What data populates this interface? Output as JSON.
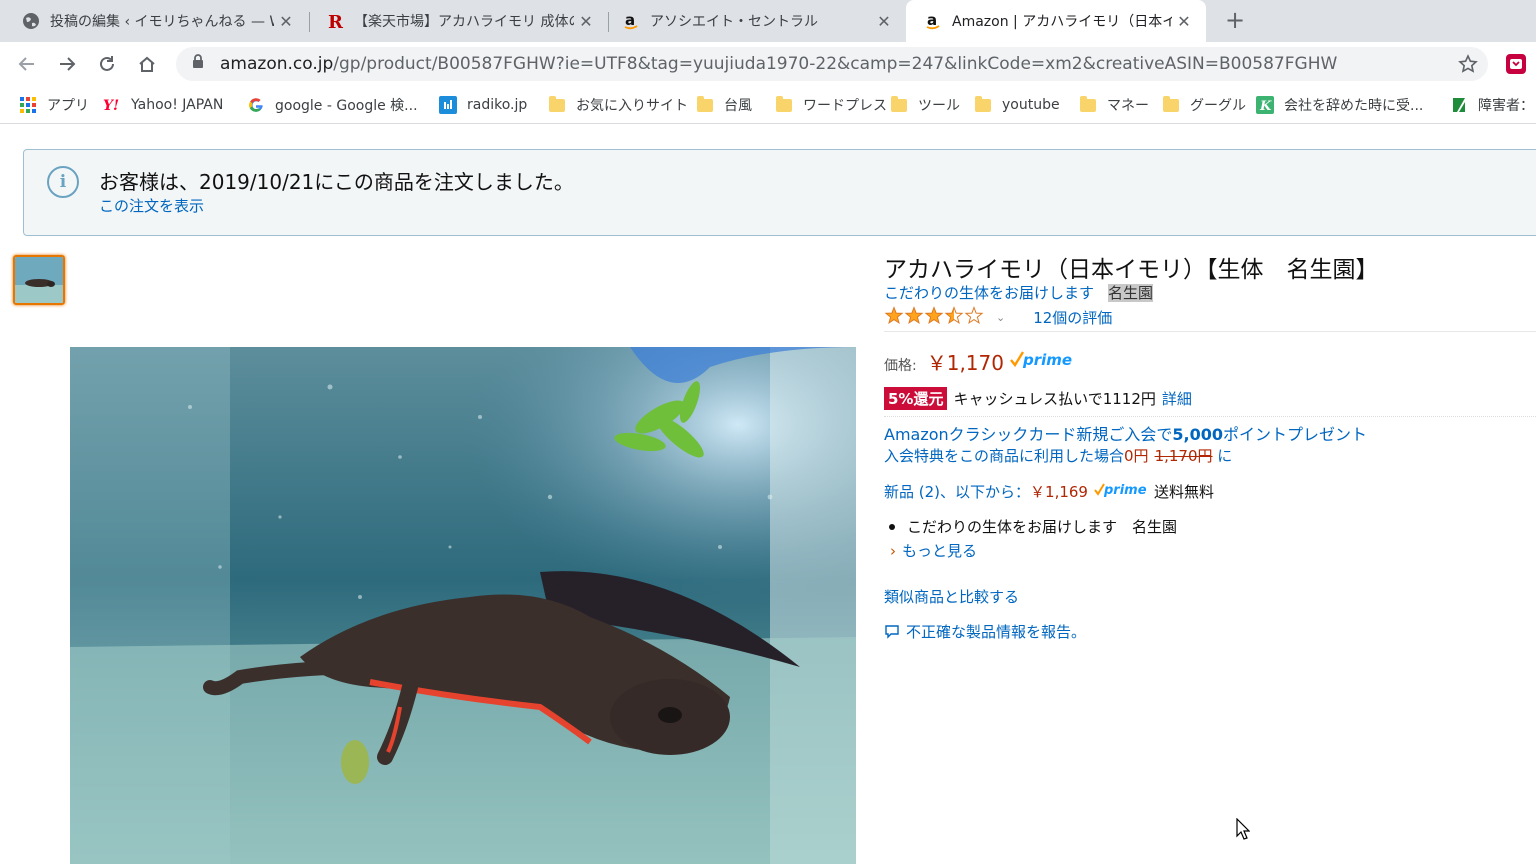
{
  "tabs": [
    {
      "title": "投稿の編集 ‹ イモリちゃんねる — WordPress",
      "favicon": "globe-icon"
    },
    {
      "title": "【楽天市場】アカハライモリ 成体の通販",
      "favicon": "rakuten-icon"
    },
    {
      "title": "アソシエイト・セントラル",
      "favicon": "amazon-icon"
    },
    {
      "title": "Amazon | アカハライモリ（日本イモリ）",
      "favicon": "amazon-icon"
    }
  ],
  "tab_close": "✕",
  "new_tab": "+",
  "url": {
    "host": "amazon.co.jp",
    "path": "/gp/product/B00587FGHW?ie=UTF8&tag=yuujiuda1970-22&camp=247&linkCode=xm2&creativeASIN=B00587FGHW"
  },
  "bookmarks": [
    {
      "label": "アプリ",
      "icon": "apps-grid-icon"
    },
    {
      "label": "Yahoo! JAPAN",
      "icon": "yahoo-icon"
    },
    {
      "label": "google - Google 検...",
      "icon": "google-icon"
    },
    {
      "label": "radiko.jp",
      "icon": "radiko-icon"
    },
    {
      "label": "お気に入りサイト",
      "icon": "folder-icon"
    },
    {
      "label": "台風",
      "icon": "folder-icon"
    },
    {
      "label": "ワードプレス",
      "icon": "folder-icon"
    },
    {
      "label": "ツール",
      "icon": "folder-icon"
    },
    {
      "label": "youtube",
      "icon": "folder-icon"
    },
    {
      "label": "マネー",
      "icon": "folder-icon"
    },
    {
      "label": "グーグル",
      "icon": "folder-icon"
    },
    {
      "label": "会社を辞めた時に受...",
      "icon": "site-k-icon"
    },
    {
      "label": "障害者：",
      "icon": "site-green-icon"
    }
  ],
  "notice": {
    "message": "お客様は、2019/10/21にこの商品を注文しました。",
    "link": "この注文を表示",
    "icon": "i"
  },
  "product": {
    "title": "アカハライモリ（日本イモリ）【生体　名生園】",
    "byline_link": "こだわりの生体をお届けします",
    "byline_store": "名生園",
    "rating_stars": 3.5,
    "rating_max": 5,
    "rating_count": "12個の評価",
    "price_label": "価格:",
    "price": "￥1,170",
    "prime": "prime",
    "cashback_badge": "5%還元",
    "cashback_text": "キャッシュレス払いで1112円",
    "cashback_link": "詳細",
    "card_line1_a": "Amazonクラシックカード新規ご入会で",
    "card_line1_b": "5,000",
    "card_line1_c": "ポイントプレゼント",
    "card_line2_a": "入会特典をこの商品に利用した場合",
    "card_line2_b": "0円",
    "card_line2_c": "1,170円",
    "card_line2_d": "に",
    "new_link": "新品 (2)、以下から：",
    "new_price": "￥1,169",
    "new_ship": "送料無料",
    "bullet": "こだわりの生体をお届けします　名生園",
    "more": "もっと見る",
    "compare": "類似商品と比較する",
    "report": "不正確な製品情報を報告。"
  },
  "colors": {
    "link": "#0066c0",
    "price": "#b12704",
    "badge": "#cc0c39",
    "star": "#ffa41c",
    "prime": "#1399ff",
    "thumb_border": "#e77600"
  }
}
